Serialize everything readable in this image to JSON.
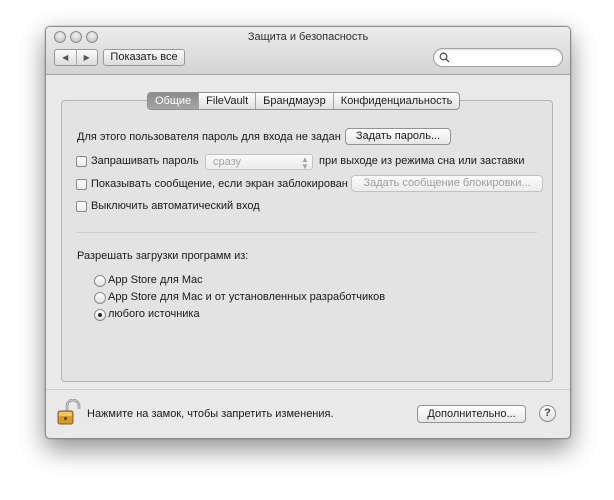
{
  "window": {
    "title": "Защита и безопасность"
  },
  "toolbar": {
    "back_icon": "chevron-left-icon",
    "forward_icon": "chevron-right-icon",
    "back_glyph": "◀",
    "forward_glyph": "▶",
    "show_all_label": "Показать все",
    "search_value": ""
  },
  "tabs": [
    {
      "label": "Общие",
      "active": true
    },
    {
      "label": "FileVault",
      "active": false
    },
    {
      "label": "Брандмауэр",
      "active": false
    },
    {
      "label": "Конфиденциальность",
      "active": false
    }
  ],
  "general": {
    "password_notice": "Для этого пользователя пароль для входа не задан",
    "set_password_button": "Задать пароль...",
    "require_password": {
      "label": "Запрашивать пароль",
      "checked": false
    },
    "require_password_delay": {
      "selected": "сразу",
      "arrows": "▲▼"
    },
    "require_password_suffix": "при выходе из режима сна или заставки",
    "show_message": {
      "label": "Показывать сообщение, если экран заблокирован",
      "checked": false
    },
    "set_lock_message_button": "Задать сообщение блокировки...",
    "disable_autologin": {
      "label": "Выключить автоматический вход",
      "checked": false
    },
    "allow_downloads_heading": "Разрешать загрузки программ из:",
    "download_options": [
      {
        "label": "App Store для Mac",
        "checked": false
      },
      {
        "label": "App Store для Mac и от установленных разработчиков",
        "checked": false
      },
      {
        "label": "любого источника",
        "checked": true
      }
    ]
  },
  "footer": {
    "lock_icon": "unlocked-padlock-icon",
    "lock_message": "Нажмите на замок, чтобы запретить изменения.",
    "advanced_button": "Дополнительно...",
    "help_label": "?"
  },
  "colors": {
    "window_bg": "#e9e9e9",
    "panel_bg": "#e3e3e3",
    "tab_active_bg": "#999999",
    "disabled_text": "#9c9c9c"
  }
}
